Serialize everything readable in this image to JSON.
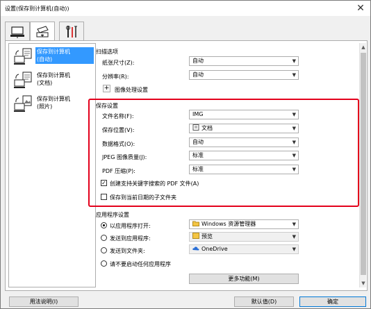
{
  "window": {
    "title": "设置(保存到计算机(自动))",
    "close": "✕"
  },
  "tabs": [
    {
      "name": "scan-to-pc-tab"
    },
    {
      "name": "save-tab"
    },
    {
      "name": "general-settings-tab"
    }
  ],
  "left_list": [
    {
      "label": "保存到计算机\n(自动)",
      "selected": true
    },
    {
      "label": "保存到计算机\n(文档)",
      "selected": false
    },
    {
      "label": "保存到计算机\n(照片)",
      "selected": false
    }
  ],
  "scan_options": {
    "title": "扫描选项",
    "paper_size_label": "纸张尺寸(Z):",
    "paper_size_value": "自动",
    "resolution_label": "分辨率(R):",
    "resolution_value": "自动",
    "image_processing_label": "图像处理设置",
    "plus": "+"
  },
  "save_settings": {
    "title": "保存设置",
    "filename_label": "文件名称(F):",
    "filename_value": "IMG",
    "save_in_label": "保存位置(V):",
    "save_in_value": "文档",
    "data_format_label": "数据格式(O):",
    "data_format_value": "自动",
    "jpeg_quality_label": "JPEG 图像质量(J):",
    "jpeg_quality_value": "标准",
    "pdf_compression_label": "PDF 压缩(P):",
    "pdf_compression_value": "标准",
    "searchable_pdf_label": "创建支持关键字搜索的 PDF 文件(A)",
    "searchable_pdf_checked": true,
    "subfolder_label": "保存到当前日期的子文件夹",
    "subfolder_checked": false
  },
  "app_settings": {
    "title": "应用程序设置",
    "open_with_label": "以应用程序打开:",
    "open_with_value": "Windows 资源管理器",
    "send_to_app_label": "发送到应用程序:",
    "send_to_app_value": "预览",
    "send_to_folder_label": "发送到文件夹:",
    "send_to_folder_value": "OneDrive",
    "do_not_start_label": "请不要启动任何应用程序",
    "more_functions_label": "更多功能(M)",
    "selected_option": "open_with"
  },
  "footer": {
    "help_label": "用法说明(I)",
    "defaults_label": "默认值(D)",
    "ok_label": "确定"
  },
  "colors": {
    "accent": "#3399ff",
    "highlight_box": "#e3001b"
  }
}
